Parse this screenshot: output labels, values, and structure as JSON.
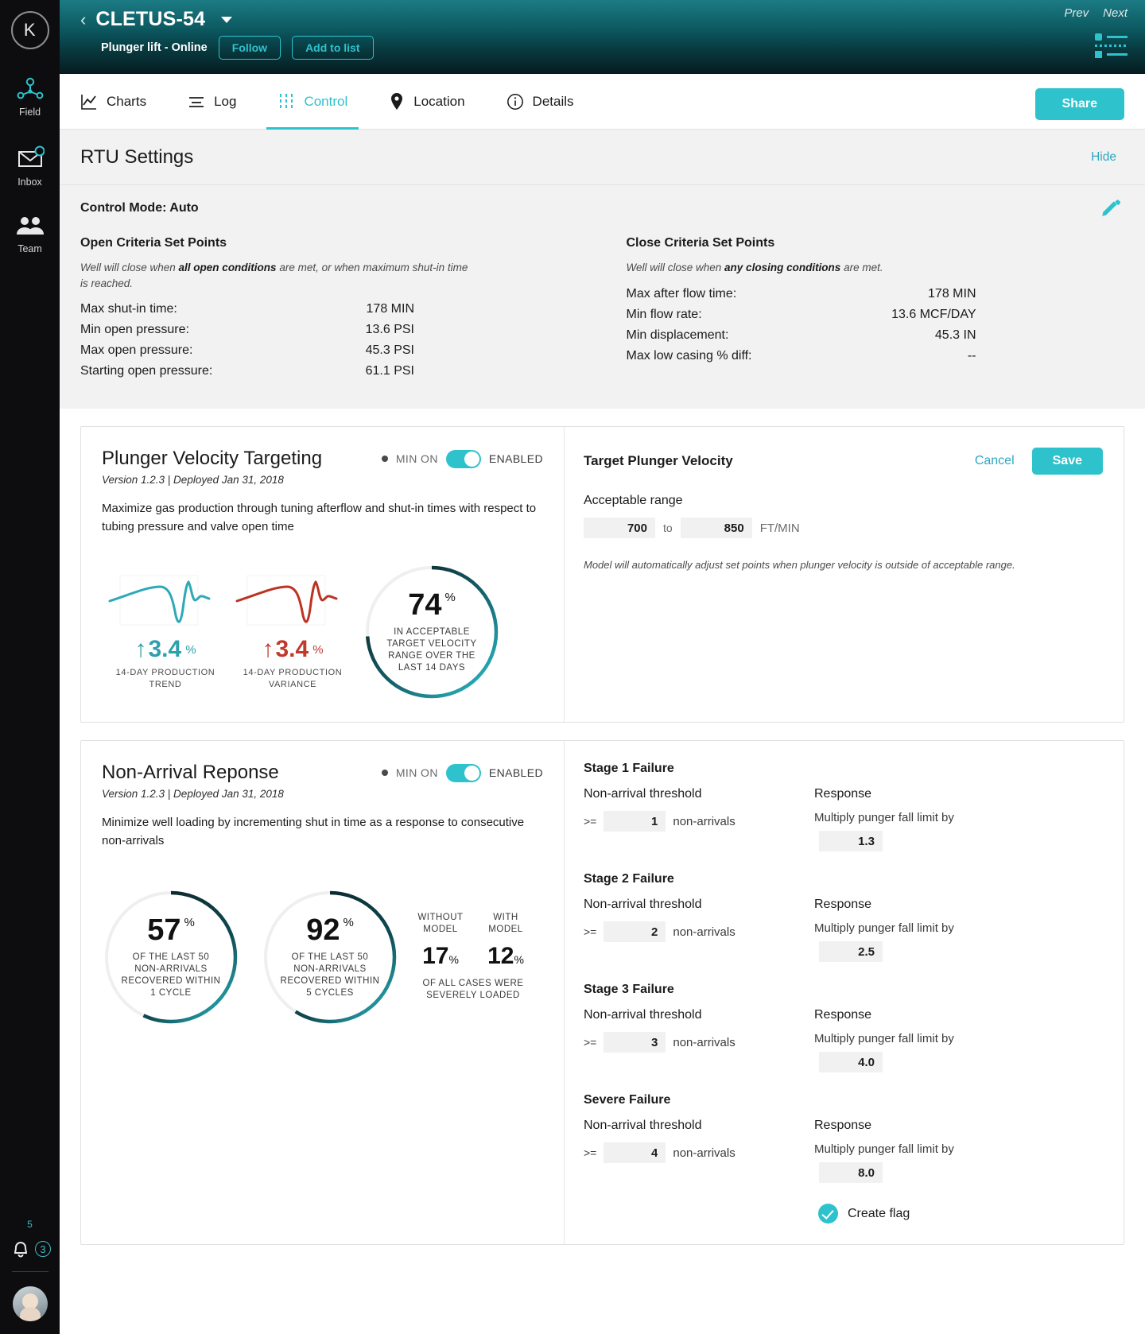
{
  "rail": {
    "logo_letter": "K",
    "items": [
      {
        "label": "Field",
        "icon": "network-nodes-icon"
      },
      {
        "label": "Inbox",
        "icon": "inbox-icon"
      },
      {
        "label": "Team",
        "icon": "team-icon"
      }
    ],
    "pending_count": "5",
    "notification_count": "3"
  },
  "wellhead": {
    "name": "CLETUS-54",
    "subtitle": "Plunger lift - Online",
    "follow_label": "Follow",
    "addtolist_label": "Add to list",
    "prev_label": "Prev",
    "next_label": "Next"
  },
  "tabs": [
    {
      "label": "Charts",
      "icon": "line-chart-icon",
      "active": false
    },
    {
      "label": "Log",
      "icon": "log-lines-icon",
      "active": false
    },
    {
      "label": "Control",
      "icon": "sliders-icon",
      "active": true
    },
    {
      "label": "Location",
      "icon": "map-pin-icon",
      "active": false
    },
    {
      "label": "Details",
      "icon": "info-circle-icon",
      "active": false
    }
  ],
  "share_label": "Share",
  "rtu": {
    "title": "RTU Settings",
    "hide_label": "Hide",
    "control_mode": "Control Mode: Auto",
    "open": {
      "heading": "Open Criteria Set Points",
      "note_pre": "Well will close when ",
      "note_bold": "all open conditions",
      "note_post": " are met, or when maximum shut-in time is reached.",
      "rows": [
        {
          "key": "Max shut-in time:",
          "value": "178 MIN"
        },
        {
          "key": "Min open pressure:",
          "value": "13.6 PSI"
        },
        {
          "key": "Max open pressure:",
          "value": "45.3 PSI"
        },
        {
          "key": "Starting open pressure:",
          "value": "61.1 PSI"
        }
      ]
    },
    "close": {
      "heading": "Close Criteria Set Points",
      "note_pre": "Well will close when ",
      "note_bold": "any closing conditions",
      "note_post": " are met.",
      "rows": [
        {
          "key": "Max after flow time:",
          "value": "178 MIN"
        },
        {
          "key": "Min flow rate:",
          "value": "13.6 MCF/DAY"
        },
        {
          "key": "Min displacement:",
          "value": "45.3 IN"
        },
        {
          "key": "Max low casing % diff:",
          "value": "--"
        }
      ]
    }
  },
  "velocity_card": {
    "title": "Plunger Velocity Targeting",
    "min_on_label": "MIN ON",
    "enabled_label": "ENABLED",
    "version": "Version 1.2.3 | Deployed Jan 31, 2018",
    "description": "Maximize gas production through tuning afterflow and shut-in times with respect to tubing pressure and valve open time",
    "stats": [
      {
        "type": "sparkline",
        "color": "#2e9fad",
        "arrow": "↑",
        "value": "3.4",
        "pct": "%",
        "caption": "14-DAY PRODUCTION TREND"
      },
      {
        "type": "sparkline",
        "color": "#c0392b",
        "arrow": "↑",
        "value": "3.4",
        "pct": "%",
        "caption": "14-DAY PRODUCTION VARIANCE"
      },
      {
        "type": "donut",
        "value": "74",
        "pct": "%",
        "caption": "IN ACCEPTABLE TARGET VELOCITY RANGE OVER THE LAST 14 DAYS"
      }
    ],
    "panel": {
      "title": "Target Plunger Velocity",
      "cancel_label": "Cancel",
      "save_label": "Save",
      "range_label": "Acceptable range",
      "min_value": "700",
      "to_label": "to",
      "max_value": "850",
      "unit": "FT/MIN",
      "note": "Model will automatically adjust set points when plunger velocity is outside of acceptable range."
    }
  },
  "nonarrival_card": {
    "title": "Non-Arrival Reponse",
    "min_on_label": "MIN ON",
    "enabled_label": "ENABLED",
    "version": "Version 1.2.3 | Deployed Jan 31, 2018",
    "description": "Minimize well loading by incrementing shut in time as a response to consecutive non-arrivals",
    "stats": [
      {
        "type": "donut",
        "value": "57",
        "pct": "%",
        "caption": "OF THE LAST 50 NON-ARRIVALS RECOVERED WITHIN 1 CYCLE"
      },
      {
        "type": "donut",
        "value": "92",
        "pct": "%",
        "caption": "OF THE LAST 50 NON-ARRIVALS RECOVERED WITHIN 5 CYCLES"
      },
      {
        "type": "compare",
        "head_left": "WITHOUT MODEL",
        "head_right": "WITH MODEL",
        "val_left": "17",
        "val_right": "12",
        "unit": "%",
        "footer": "OF ALL CASES WERE SEVERELY LOADED"
      }
    ],
    "stages": [
      {
        "title": "Stage 1 Failure",
        "threshold_label": "Non-arrival threshold",
        "gte": ">=",
        "threshold": "1",
        "threshold_unit": "non-arrivals",
        "response_label": "Response",
        "response_text": "Multiply punger fall limit by",
        "response_value": "1.3"
      },
      {
        "title": "Stage 2 Failure",
        "threshold_label": "Non-arrival threshold",
        "gte": ">=",
        "threshold": "2",
        "threshold_unit": "non-arrivals",
        "response_label": "Response",
        "response_text": "Multiply punger fall limit by",
        "response_value": "2.5"
      },
      {
        "title": "Stage 3 Failure",
        "threshold_label": "Non-arrival threshold",
        "gte": ">=",
        "threshold": "3",
        "threshold_unit": "non-arrivals",
        "response_label": "Response",
        "response_text": "Multiply punger fall limit by",
        "response_value": "4.0"
      },
      {
        "title": "Severe Failure",
        "threshold_label": "Non-arrival threshold",
        "gte": ">=",
        "threshold": "4",
        "threshold_unit": "non-arrivals",
        "response_label": "Response",
        "response_text": "Multiply punger fall limit by",
        "response_value": "8.0"
      }
    ],
    "create_flag_label": "Create flag"
  },
  "colors": {
    "accent": "#2ec2cd",
    "link": "#2ea6c0",
    "trend_up": "#2e9fad",
    "variance": "#c0392b",
    "dark": "#0d0d0f"
  }
}
